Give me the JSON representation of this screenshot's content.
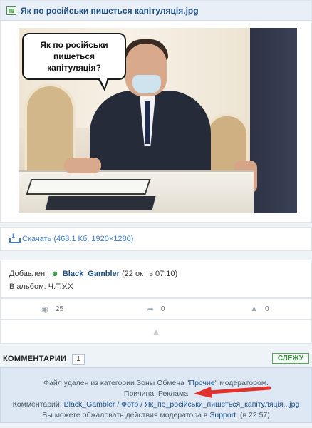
{
  "file": {
    "title": "Як по російськи пишеться капітуляція.jpg",
    "bubble_text": "Як по російськи\nпишеться\nкапітуляція?"
  },
  "download": {
    "label": "Скачать",
    "meta": "(468.1 Кб, 1920×1280)"
  },
  "info": {
    "added_label": "Добавлен:",
    "username": "Black_Gambler",
    "date": "(22 окт в 07:10)",
    "album_label": "В альбом:",
    "album_name": "Ч.Т.У.Х"
  },
  "stats": {
    "views": "25",
    "shares": "0",
    "likes": "0"
  },
  "comments": {
    "title": "КОММЕНТАРИИ",
    "count": "1",
    "follow_label": "СЛЕЖУ"
  },
  "notice": {
    "line1_a": "Файл удален из категории Зоны Обмена \"",
    "line1_link": "Прочие",
    "line1_b": "\" модератором.",
    "line2": "Причина: Реклама",
    "line3_a": "Комментарий: ",
    "line3_link": "Black_Gambler / Фото / Як_по_російськи_пишеться_капітуляція...jpg",
    "line4_a": "Вы можете обжаловать действия модератора в ",
    "line4_link": "Support",
    "line4_b": ". (в 22:57)"
  },
  "colors": {
    "accent": "#1d4f86",
    "link": "#3d7cc9",
    "green": "#3a8a45",
    "arrow": "#e0332e",
    "notice_bg": "#dde8f4"
  },
  "icons": [
    "image-file-icon",
    "download-icon",
    "user-icon",
    "eye-icon",
    "share-icon",
    "like-icon"
  ]
}
